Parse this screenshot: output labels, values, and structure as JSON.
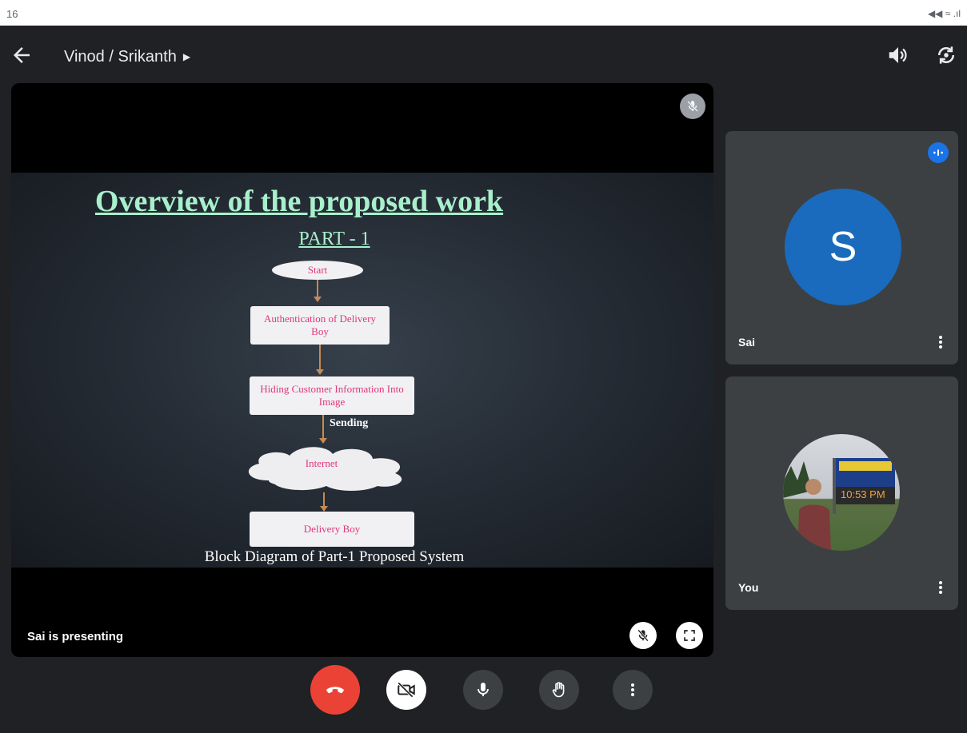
{
  "status_bar": {
    "time": "16",
    "indicators": "◀◀ ≈ .ıl"
  },
  "header": {
    "title": "Vinod / Srikanth",
    "icons": [
      "back-arrow-icon",
      "speaker-icon",
      "switch-camera-icon"
    ]
  },
  "presentation": {
    "slide_title": "Overview of the proposed work",
    "slide_subtitle": "PART - 1",
    "flow": {
      "start": "Start",
      "auth": "Authentication of Delivery Boy",
      "hide": "Hiding Customer Information Into Image",
      "sending": "Sending",
      "internet": "Internet",
      "delivery": "Delivery Boy"
    },
    "caption": "Block Diagram of Part-1 Proposed System",
    "presenting_label": "Sai is presenting"
  },
  "participants": [
    {
      "name": "Sai",
      "initial": "S",
      "avatar_color": "#1a6bbd",
      "speaking": true
    },
    {
      "name": "You",
      "photo_text": "10:53 PM"
    }
  ],
  "controls": [
    "end-call",
    "camera-off",
    "microphone",
    "raise-hand",
    "more-options"
  ],
  "colors": {
    "background": "#202124",
    "tile": "#3c4043",
    "end_call": "#ea4335",
    "accent": "#1a73e8",
    "slide_title": "#a8f0cc",
    "flow_text": "#e0357a"
  }
}
